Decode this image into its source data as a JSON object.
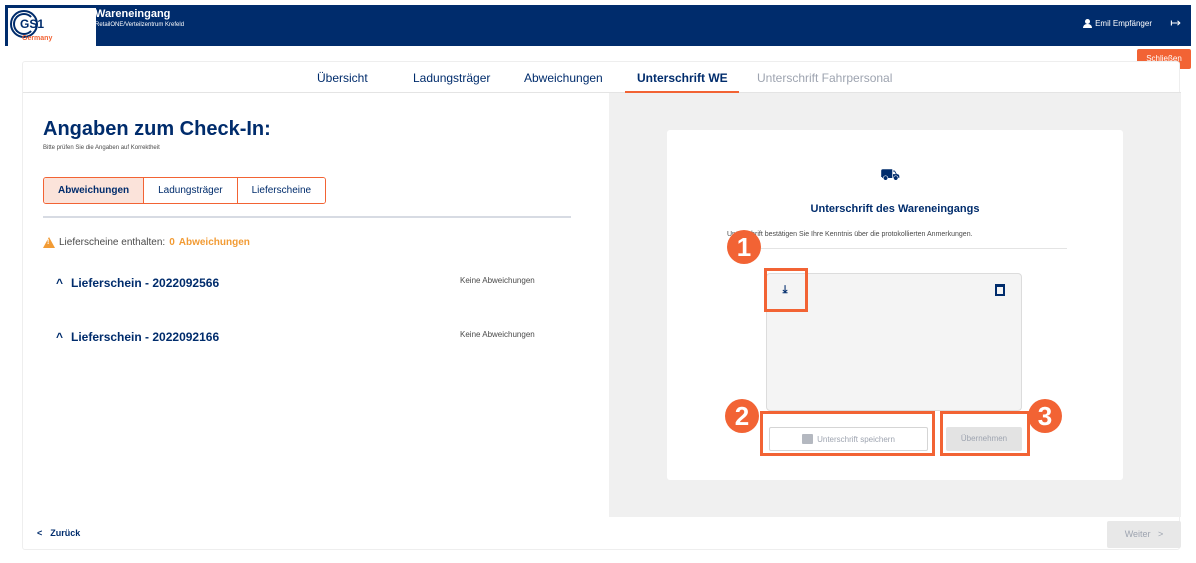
{
  "header": {
    "logo_text": "GS1",
    "logo_sub": "Germany",
    "title": "Wareneingang",
    "subtitle": "RetailONE/Verteilzentrum Krefeld",
    "user": "Emil Empfänger",
    "close_label": "Schließen"
  },
  "tabs": [
    {
      "label": "Übersicht"
    },
    {
      "label": "Ladungsträger"
    },
    {
      "label": "Abweichungen"
    },
    {
      "label": "Unterschrift WE"
    },
    {
      "label": "Unterschrift Fahrpersonal"
    }
  ],
  "left": {
    "title": "Angaben zum Check-In:",
    "subtitle": "Bitte prüfen Sie die Angaben auf Korrektheit",
    "segments": [
      "Abweichungen",
      "Ladungsträger",
      "Lieferscheine"
    ],
    "warning_label": "Lieferscheine enthalten:",
    "warning_count": "0",
    "warning_word": "Abweichungen",
    "lieferscheine": [
      {
        "caret": "^",
        "label": "Lieferschein - 2022092566",
        "status": "Keine Abweichungen"
      },
      {
        "caret": "^",
        "label": "Lieferschein - 2022092166",
        "status": "Keine Abweichungen"
      }
    ]
  },
  "signature": {
    "title": "Unterschrift des Wareneingangs",
    "description": "Unterschrift bestätigen Sie Ihre Kenntnis über die protokollierten Anmerkungen.",
    "save_label": "Unterschrift speichern",
    "accept_label": "Übernehmen"
  },
  "footer": {
    "back_label": "Zurück",
    "next_label": "Weiter"
  },
  "callouts": [
    "1",
    "2",
    "3"
  ],
  "colors": {
    "brand": "#002c6c",
    "accent": "#f26334",
    "warning": "#f29b34"
  }
}
